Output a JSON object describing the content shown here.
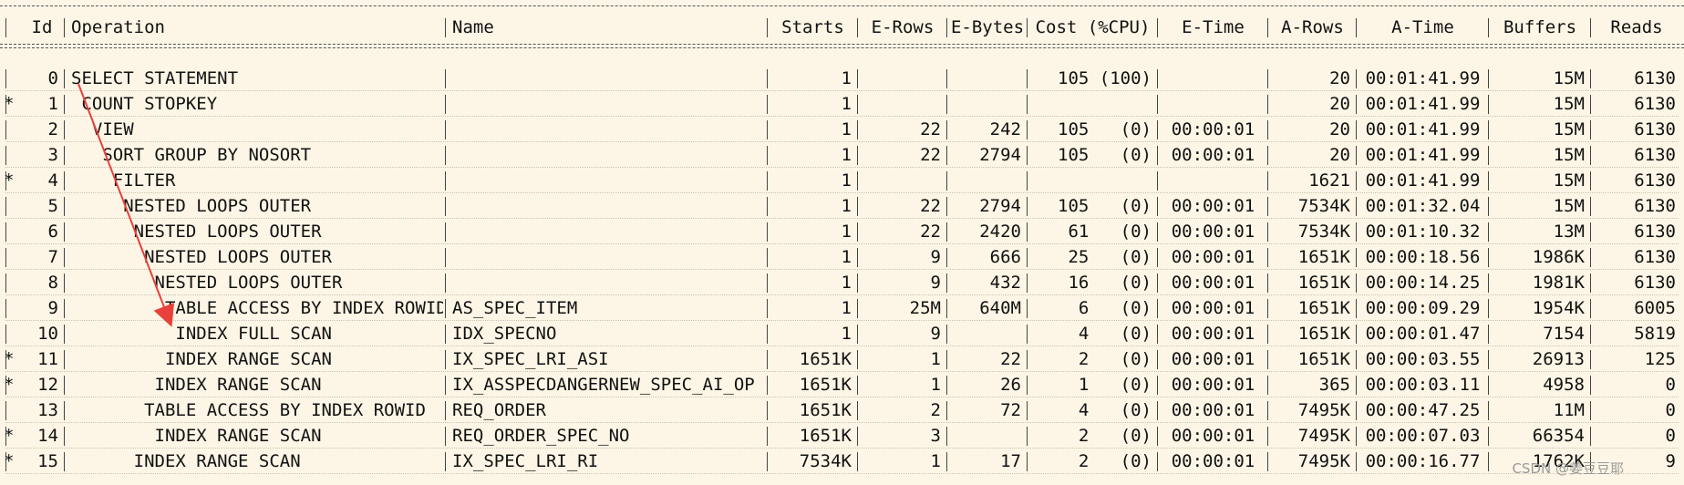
{
  "headers": [
    "Id",
    "Operation",
    "Name",
    "Starts",
    "E-Rows",
    "E-Bytes",
    "Cost (%CPU)",
    "E-Time",
    "A-Rows",
    "A-Time",
    "Buffers",
    "Reads"
  ],
  "rows": [
    {
      "star": "",
      "id": "0",
      "operation": "SELECT STATEMENT",
      "name": "",
      "starts": "1",
      "erows": "",
      "ebytes": "",
      "cost": "105 (100)",
      "etime": "",
      "arows": "20",
      "atime": "00:01:41.99",
      "buffers": "15M",
      "reads": "6130"
    },
    {
      "star": "*",
      "id": "1",
      "operation": " COUNT STOPKEY",
      "name": "",
      "starts": "1",
      "erows": "",
      "ebytes": "",
      "cost": "",
      "etime": "",
      "arows": "20",
      "atime": "00:01:41.99",
      "buffers": "15M",
      "reads": "6130"
    },
    {
      "star": "",
      "id": "2",
      "operation": "  VIEW",
      "name": "",
      "starts": "1",
      "erows": "22",
      "ebytes": "242",
      "cost": "105   (0)",
      "etime": "00:00:01",
      "arows": "20",
      "atime": "00:01:41.99",
      "buffers": "15M",
      "reads": "6130"
    },
    {
      "star": "",
      "id": "3",
      "operation": "   SORT GROUP BY NOSORT",
      "name": "",
      "starts": "1",
      "erows": "22",
      "ebytes": "2794",
      "cost": "105   (0)",
      "etime": "00:00:01",
      "arows": "20",
      "atime": "00:01:41.99",
      "buffers": "15M",
      "reads": "6130"
    },
    {
      "star": "*",
      "id": "4",
      "operation": "    FILTER",
      "name": "",
      "starts": "1",
      "erows": "",
      "ebytes": "",
      "cost": "",
      "etime": "",
      "arows": "1621",
      "atime": "00:01:41.99",
      "buffers": "15M",
      "reads": "6130"
    },
    {
      "star": "",
      "id": "5",
      "operation": "     NESTED LOOPS OUTER",
      "name": "",
      "starts": "1",
      "erows": "22",
      "ebytes": "2794",
      "cost": "105   (0)",
      "etime": "00:00:01",
      "arows": "7534K",
      "atime": "00:01:32.04",
      "buffers": "15M",
      "reads": "6130"
    },
    {
      "star": "",
      "id": "6",
      "operation": "      NESTED LOOPS OUTER",
      "name": "",
      "starts": "1",
      "erows": "22",
      "ebytes": "2420",
      "cost": "61   (0)",
      "etime": "00:00:01",
      "arows": "7534K",
      "atime": "00:01:10.32",
      "buffers": "13M",
      "reads": "6130"
    },
    {
      "star": "",
      "id": "7",
      "operation": "       NESTED LOOPS OUTER",
      "name": "",
      "starts": "1",
      "erows": "9",
      "ebytes": "666",
      "cost": "25   (0)",
      "etime": "00:00:01",
      "arows": "1651K",
      "atime": "00:00:18.56",
      "buffers": "1986K",
      "reads": "6130"
    },
    {
      "star": "",
      "id": "8",
      "operation": "        NESTED LOOPS OUTER",
      "name": "",
      "starts": "1",
      "erows": "9",
      "ebytes": "432",
      "cost": "16   (0)",
      "etime": "00:00:01",
      "arows": "1651K",
      "atime": "00:00:14.25",
      "buffers": "1981K",
      "reads": "6130"
    },
    {
      "star": "",
      "id": "9",
      "operation": "         TABLE ACCESS BY INDEX ROWID",
      "name": "AS_SPEC_ITEM",
      "starts": "1",
      "erows": "25M",
      "ebytes": "640M",
      "cost": "6   (0)",
      "etime": "00:00:01",
      "arows": "1651K",
      "atime": "00:00:09.29",
      "buffers": "1954K",
      "reads": "6005"
    },
    {
      "star": "",
      "id": "10",
      "operation": "          INDEX FULL SCAN",
      "name": "IDX_SPECNO",
      "starts": "1",
      "erows": "9",
      "ebytes": "",
      "cost": "4   (0)",
      "etime": "00:00:01",
      "arows": "1651K",
      "atime": "00:00:01.47",
      "buffers": "7154",
      "reads": "5819"
    },
    {
      "star": "*",
      "id": "11",
      "operation": "         INDEX RANGE SCAN",
      "name": "IX_SPEC_LRI_ASI",
      "starts": "1651K",
      "erows": "1",
      "ebytes": "22",
      "cost": "2   (0)",
      "etime": "00:00:01",
      "arows": "1651K",
      "atime": "00:00:03.55",
      "buffers": "26913",
      "reads": "125"
    },
    {
      "star": "*",
      "id": "12",
      "operation": "        INDEX RANGE SCAN",
      "name": "IX_ASSPECDANGERNEW_SPEC_AI_OP",
      "starts": "1651K",
      "erows": "1",
      "ebytes": "26",
      "cost": "1   (0)",
      "etime": "00:00:01",
      "arows": "365",
      "atime": "00:00:03.11",
      "buffers": "4958",
      "reads": "0"
    },
    {
      "star": "",
      "id": "13",
      "operation": "       TABLE ACCESS BY INDEX ROWID",
      "name": "REQ_ORDER",
      "starts": "1651K",
      "erows": "2",
      "ebytes": "72",
      "cost": "4   (0)",
      "etime": "00:00:01",
      "arows": "7495K",
      "atime": "00:00:47.25",
      "buffers": "11M",
      "reads": "0"
    },
    {
      "star": "*",
      "id": "14",
      "operation": "        INDEX RANGE SCAN",
      "name": "REQ_ORDER_SPEC_NO",
      "starts": "1651K",
      "erows": "3",
      "ebytes": "",
      "cost": "2   (0)",
      "etime": "00:00:01",
      "arows": "7495K",
      "atime": "00:00:07.03",
      "buffers": "66354",
      "reads": "0"
    },
    {
      "star": "*",
      "id": "15",
      "operation": "      INDEX RANGE SCAN",
      "name": "IX_SPEC_LRI_RI",
      "starts": "7534K",
      "erows": "1",
      "ebytes": "17",
      "cost": "2   (0)",
      "etime": "00:00:01",
      "arows": "7495K",
      "atime": "00:00:16.77",
      "buffers": "1762K",
      "reads": "9"
    }
  ],
  "watermark": "CSDN @姜豆豆耶",
  "colors": {
    "background": "#fdf6e6",
    "arrow": "#e8403a"
  }
}
